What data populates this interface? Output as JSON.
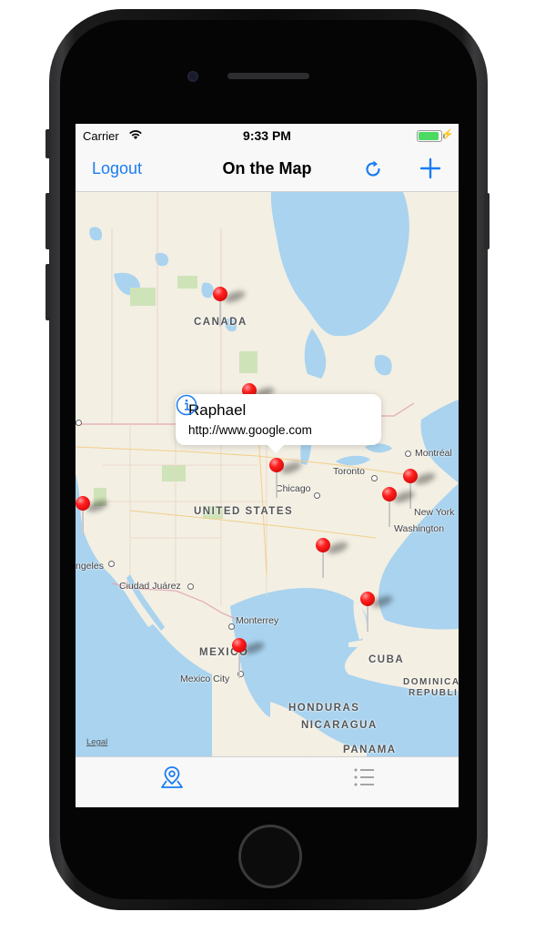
{
  "status_bar": {
    "carrier": "Carrier",
    "time": "9:33 PM",
    "battery_level": 1.0,
    "charging": true
  },
  "navbar": {
    "left_button": "Logout",
    "title": "On the Map",
    "refresh_icon": "refresh-icon",
    "add_icon": "plus-icon"
  },
  "map": {
    "labels": {
      "canada": "CANADA",
      "united_states": "UNITED STATES",
      "mexico": "MEXICO",
      "cuba": "CUBA",
      "honduras": "HONDURAS",
      "nicaragua": "NICARAGUA",
      "panama": "PANAMA",
      "dominican_republic_1": "DOMINICA",
      "dominican_republic_2": "REPUBLIC",
      "montreal": "Montréal",
      "toronto": "Toronto",
      "chicago": "Chicago",
      "new_york": "New York",
      "washington": "Washington",
      "los_angeles": "ngeles",
      "ciudad_juarez": "Ciudad Juárez",
      "monterrey": "Monterrey",
      "mexico_city": "Mexico City"
    },
    "legal": "Legal",
    "callout": {
      "name": "Raphael",
      "url": "http://www.google.com",
      "info_icon": "info-icon"
    }
  },
  "tabbar": {
    "items": [
      {
        "icon": "map-pin-icon",
        "selected": true
      },
      {
        "icon": "list-icon",
        "selected": false
      }
    ]
  },
  "colors": {
    "accent": "#1a7cf2",
    "pin": "#ff1e1e",
    "water": "#a9d3ef",
    "land": "#f3efe3"
  }
}
